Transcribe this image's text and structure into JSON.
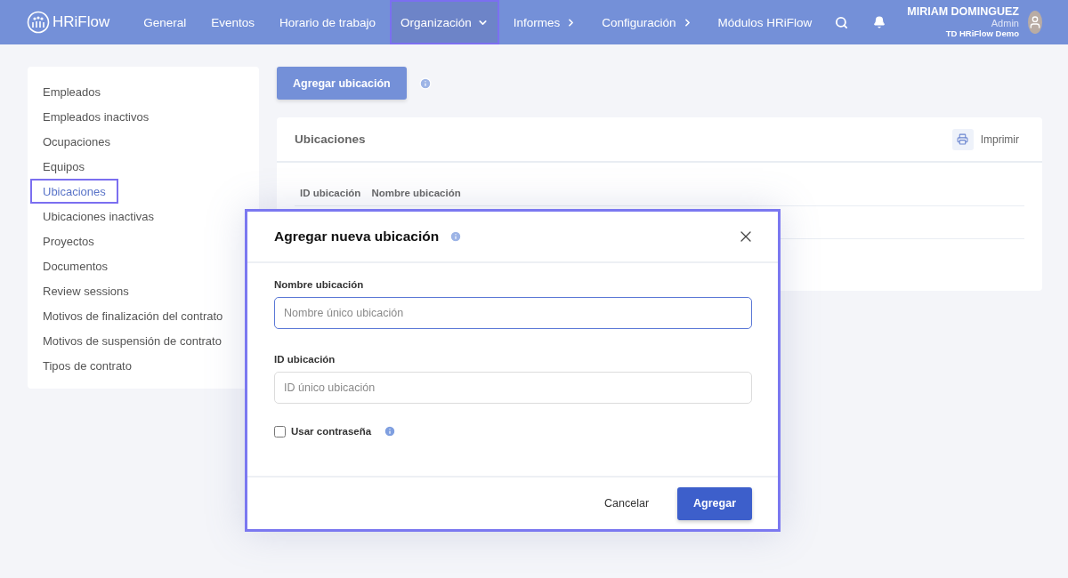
{
  "header": {
    "logo": "HRiFlow",
    "nav": [
      {
        "label": "General",
        "kind": "plain",
        "selected": false
      },
      {
        "label": "Eventos",
        "kind": "plain",
        "selected": false
      },
      {
        "label": "Horario de trabajo",
        "kind": "plain",
        "selected": false
      },
      {
        "label": "Organización",
        "kind": "dropdown",
        "selected": true
      },
      {
        "label": "Informes",
        "kind": "submenu",
        "selected": false
      },
      {
        "label": "Configuración",
        "kind": "submenu",
        "selected": false
      },
      {
        "label": "Módulos HRiFlow",
        "kind": "plain",
        "selected": false
      }
    ],
    "user": {
      "name": "MIRIAM DOMINGUEZ",
      "role": "Admin",
      "company": "TD HRiFlow Demo"
    }
  },
  "sidebar": {
    "items": [
      {
        "label": "Empleados",
        "selected": false
      },
      {
        "label": "Empleados inactivos",
        "selected": false
      },
      {
        "label": "Ocupaciones",
        "selected": false
      },
      {
        "label": "Equipos",
        "selected": false
      },
      {
        "label": "Ubicaciones",
        "selected": true
      },
      {
        "label": "Ubicaciones inactivas",
        "selected": false
      },
      {
        "label": "Proyectos",
        "selected": false
      },
      {
        "label": "Documentos",
        "selected": false
      },
      {
        "label": "Review sessions",
        "selected": false
      },
      {
        "label": "Motivos de finalización del contrato",
        "selected": false
      },
      {
        "label": "Motivos de suspensión de contrato",
        "selected": false
      },
      {
        "label": "Tipos de contrato",
        "selected": false
      }
    ]
  },
  "add_button": "Agregar ubicación",
  "card": {
    "title": "Ubicaciones",
    "print": "Imprimir",
    "columns": [
      "ID ubicación",
      "Nombre ubicación"
    ]
  },
  "modal": {
    "title": "Agregar nueva ubicación",
    "fields": [
      {
        "label": "Nombre ubicación",
        "placeholder": "Nombre único ubicación",
        "focused": true
      },
      {
        "label": "ID ubicación",
        "placeholder": "ID único ubicación",
        "focused": false
      }
    ],
    "checkbox": {
      "label": "Usar contraseña",
      "checked": false
    },
    "cancel": "Cancelar",
    "submit": "Agregar"
  }
}
